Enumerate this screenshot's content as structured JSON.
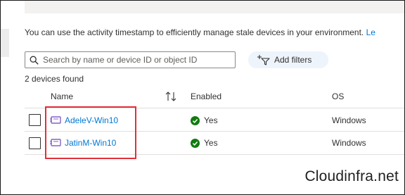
{
  "info": {
    "text": "You can use the activity timestamp to efficiently manage stale devices in your environment.",
    "link_text": "Le"
  },
  "search": {
    "placeholder": "Search by name or device ID or object ID",
    "icon": "search-icon"
  },
  "filters": {
    "label": "Add filters",
    "icon": "add-filter-icon"
  },
  "results": {
    "count_text": "2 devices found"
  },
  "table": {
    "columns": [
      "Name",
      "Enabled",
      "OS"
    ],
    "rows": [
      {
        "name": "AdeleV-Win10",
        "enabled": "Yes",
        "os": "Windows"
      },
      {
        "name": "JatinM-Win10",
        "enabled": "Yes",
        "os": "Windows"
      }
    ]
  },
  "colors": {
    "link": "#0078d4",
    "highlight": "#e0303a",
    "success": "#107c10",
    "device_icon": "#8661c5"
  },
  "watermark": "Cloudinfra.net"
}
